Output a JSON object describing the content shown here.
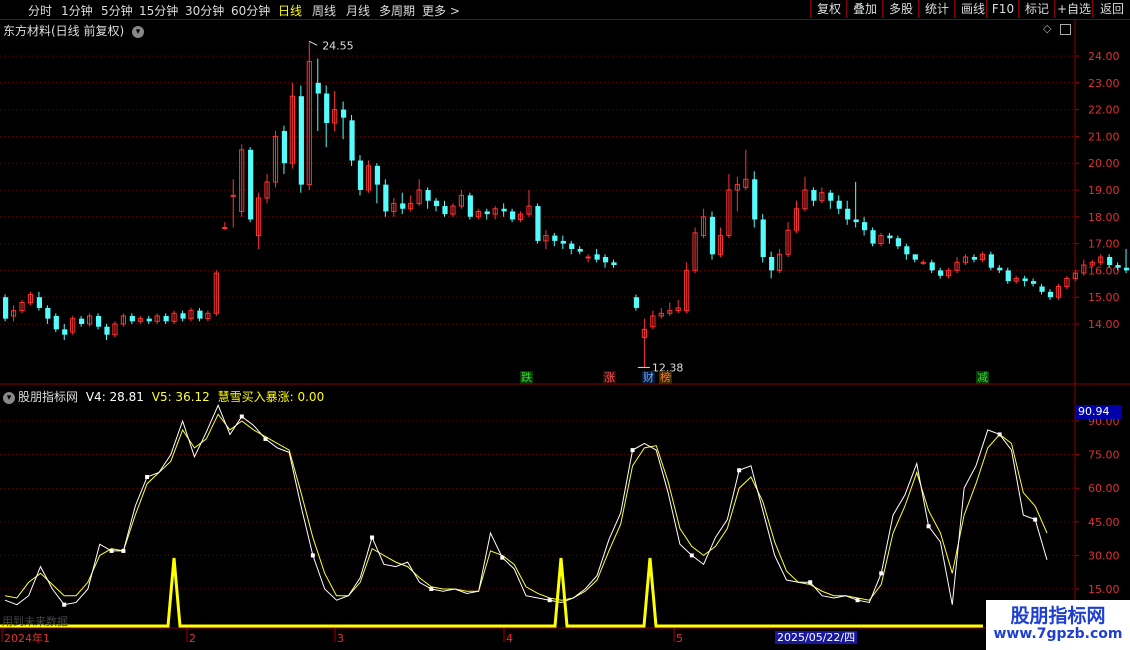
{
  "toolbar": {
    "periods": [
      "分时",
      "1分钟",
      "5分钟",
      "15分钟",
      "30分钟",
      "60分钟",
      "日线",
      "周线",
      "月线",
      "多周期",
      "更多 >"
    ],
    "active_period": "日线",
    "right_buttons": [
      "复权",
      "叠加",
      "多股",
      "统计",
      "画线",
      "F10",
      "标记",
      "+自选",
      "返回"
    ]
  },
  "stock_title": "东方材料(日线 前复权)",
  "main_axis_labels": [
    "24.00",
    "23.00",
    "22.00",
    "21.00",
    "20.00",
    "19.00",
    "18.00",
    "17.00",
    "16.00",
    "15.00",
    "14.00"
  ],
  "high_label": "24.55",
  "low_label": "12.38",
  "signals": [
    {
      "text": "跌",
      "color": "#33dd33",
      "bg": "#0a3a0a"
    },
    {
      "text": "涨",
      "color": "#ff5555",
      "bg": "#3a0a0a"
    },
    {
      "text": "财",
      "color": "#66aaff",
      "bg": "#0a1a3a"
    },
    {
      "text": "榜",
      "color": "#ff7733",
      "bg": "#3a2a00"
    },
    {
      "text": "减",
      "color": "#33dd33",
      "bg": "#0a3a0a"
    }
  ],
  "indicator": {
    "name": "股朋指标网",
    "v4_label": "V4: 28.81",
    "v5_label": "V5: 36.12",
    "buy_label": "慧雪买入暴涨: 0.00",
    "top_value": "90.94",
    "axis_labels": [
      "90.00",
      "75.00",
      "60.00",
      "45.00",
      "30.00",
      "15.00"
    ]
  },
  "ghost_text": "用到未来数据",
  "date_axis": [
    "2024年1",
    "2",
    "3",
    "4",
    "5"
  ],
  "date_highlight": "2025/05/22/四",
  "watermark": {
    "line1": "股朋指标网",
    "line2": "www.7gpzb.com"
  },
  "colors": {
    "up": "#ff3232",
    "down": "#54fcfc",
    "v4": "#ffffff",
    "v5": "#ffff33",
    "buy": "#ffff00",
    "grid": "#6e0000"
  },
  "chart_data": [
    {
      "type": "candlestick",
      "title": "东方材料(日线 前复权)",
      "ylim": [
        13.0,
        24.9
      ],
      "y_ticks": [
        14,
        15,
        16,
        17,
        18,
        19,
        20,
        21,
        22,
        23,
        24
      ],
      "annotations": [
        {
          "text": "24.55",
          "value": 24.55
        },
        {
          "text": "12.38",
          "value": 12.38
        }
      ],
      "candles": [
        [
          15.0,
          14.2,
          15.1,
          14.1
        ],
        [
          14.3,
          14.5,
          14.7,
          14.1
        ],
        [
          14.5,
          14.8,
          14.9,
          14.4
        ],
        [
          14.8,
          15.1,
          15.2,
          14.7
        ],
        [
          15.0,
          14.6,
          15.2,
          14.5
        ],
        [
          14.6,
          14.2,
          14.7,
          14.0
        ],
        [
          14.3,
          13.8,
          14.4,
          13.7
        ],
        [
          13.8,
          13.6,
          14.0,
          13.4
        ],
        [
          13.7,
          14.2,
          14.3,
          13.6
        ],
        [
          14.2,
          14.0,
          14.3,
          13.9
        ],
        [
          14.0,
          14.3,
          14.4,
          13.9
        ],
        [
          14.3,
          13.9,
          14.4,
          13.8
        ],
        [
          13.9,
          13.6,
          14.0,
          13.4
        ],
        [
          13.6,
          14.0,
          14.1,
          13.5
        ],
        [
          14.0,
          14.3,
          14.4,
          13.9
        ],
        [
          14.3,
          14.1,
          14.4,
          14.0
        ],
        [
          14.1,
          14.2,
          14.3,
          14.0
        ],
        [
          14.2,
          14.1,
          14.3,
          14.0
        ],
        [
          14.1,
          14.3,
          14.4,
          14.0
        ],
        [
          14.3,
          14.1,
          14.4,
          14.0
        ],
        [
          14.1,
          14.4,
          14.5,
          14.0
        ],
        [
          14.4,
          14.2,
          14.5,
          14.1
        ],
        [
          14.2,
          14.5,
          14.6,
          14.1
        ],
        [
          14.5,
          14.2,
          14.6,
          14.1
        ],
        [
          14.2,
          14.4,
          14.5,
          14.1
        ],
        [
          14.4,
          15.9,
          16.0,
          14.3
        ],
        [
          17.6,
          17.6,
          17.8,
          17.5
        ],
        [
          18.8,
          18.8,
          19.4,
          17.6
        ],
        [
          18.2,
          20.5,
          20.7,
          18.0
        ],
        [
          20.5,
          17.9,
          20.6,
          17.8
        ],
        [
          17.3,
          18.7,
          18.9,
          16.8
        ],
        [
          18.7,
          19.3,
          19.6,
          18.5
        ],
        [
          19.3,
          21.0,
          21.2,
          19.1
        ],
        [
          21.2,
          20.0,
          21.4,
          19.6
        ],
        [
          20.0,
          22.5,
          23.0,
          19.8
        ],
        [
          22.5,
          19.2,
          22.9,
          18.9
        ],
        [
          19.2,
          23.8,
          24.55,
          19.0
        ],
        [
          23.0,
          22.6,
          23.9,
          21.2
        ],
        [
          22.6,
          21.5,
          22.9,
          20.6
        ],
        [
          21.5,
          22.0,
          22.7,
          21.2
        ],
        [
          22.0,
          21.7,
          22.3,
          20.9
        ],
        [
          21.6,
          20.1,
          21.8,
          19.9
        ],
        [
          20.1,
          19.0,
          20.3,
          18.8
        ],
        [
          19.0,
          19.9,
          20.1,
          18.9
        ],
        [
          19.9,
          19.2,
          20.0,
          18.5
        ],
        [
          19.2,
          18.2,
          19.4,
          18.0
        ],
        [
          18.2,
          18.5,
          18.7,
          18.0
        ],
        [
          18.5,
          18.3,
          18.9,
          18.1
        ],
        [
          18.3,
          18.5,
          18.8,
          18.2
        ],
        [
          18.5,
          19.0,
          19.4,
          18.4
        ],
        [
          19.0,
          18.6,
          19.1,
          18.3
        ],
        [
          18.6,
          18.4,
          18.7,
          18.2
        ],
        [
          18.4,
          18.1,
          18.6,
          18.0
        ],
        [
          18.1,
          18.4,
          18.5,
          18.0
        ],
        [
          18.4,
          18.8,
          19.0,
          18.3
        ],
        [
          18.8,
          18.0,
          18.9,
          17.9
        ],
        [
          18.0,
          18.2,
          18.3,
          17.9
        ],
        [
          18.2,
          18.1,
          18.3,
          17.9
        ],
        [
          18.1,
          18.3,
          18.4,
          17.9
        ],
        [
          18.3,
          18.2,
          18.5,
          18.0
        ],
        [
          18.2,
          17.9,
          18.3,
          17.8
        ],
        [
          17.9,
          18.1,
          18.2,
          17.8
        ],
        [
          18.1,
          18.4,
          19.0,
          18.0
        ],
        [
          18.4,
          17.1,
          18.5,
          17.0
        ],
        [
          17.1,
          17.3,
          17.5,
          16.8
        ],
        [
          17.3,
          17.1,
          17.4,
          16.9
        ],
        [
          17.1,
          17.0,
          17.3,
          16.8
        ],
        [
          17.0,
          16.8,
          17.1,
          16.6
        ],
        [
          16.8,
          16.7,
          16.9,
          16.6
        ],
        [
          16.5,
          16.5,
          16.6,
          16.3
        ],
        [
          16.6,
          16.4,
          16.8,
          16.3
        ],
        [
          16.5,
          16.3,
          16.6,
          16.1
        ],
        [
          16.3,
          16.2,
          16.4,
          16.1
        ],
        [
          15.0,
          14.6,
          15.1,
          14.5
        ],
        [
          13.5,
          13.8,
          14.2,
          12.38
        ],
        [
          13.9,
          14.3,
          14.5,
          13.8
        ],
        [
          14.3,
          14.4,
          14.6,
          14.2
        ],
        [
          14.4,
          14.5,
          14.8,
          14.3
        ],
        [
          14.5,
          14.6,
          14.9,
          14.4
        ],
        [
          14.5,
          16.0,
          16.3,
          14.4
        ],
        [
          16.0,
          17.4,
          17.6,
          15.9
        ],
        [
          17.3,
          18.0,
          18.3,
          17.2
        ],
        [
          18.0,
          16.6,
          18.2,
          16.4
        ],
        [
          16.6,
          17.3,
          17.6,
          16.5
        ],
        [
          17.3,
          19.0,
          19.6,
          17.2
        ],
        [
          19.0,
          19.2,
          19.5,
          18.2
        ],
        [
          19.1,
          19.4,
          20.5,
          19.0
        ],
        [
          19.4,
          17.9,
          19.7,
          17.6
        ],
        [
          17.9,
          16.5,
          18.1,
          16.3
        ],
        [
          16.5,
          16.0,
          16.7,
          15.7
        ],
        [
          16.0,
          16.6,
          16.8,
          15.9
        ],
        [
          16.6,
          17.5,
          17.8,
          16.5
        ],
        [
          17.5,
          18.3,
          18.6,
          17.4
        ],
        [
          18.3,
          19.0,
          19.5,
          18.2
        ],
        [
          19.0,
          18.6,
          19.1,
          18.4
        ],
        [
          18.6,
          18.9,
          19.1,
          18.5
        ],
        [
          18.9,
          18.6,
          19.0,
          18.3
        ],
        [
          18.6,
          18.3,
          18.8,
          18.1
        ],
        [
          18.3,
          17.9,
          18.6,
          17.7
        ],
        [
          17.9,
          17.8,
          19.3,
          17.6
        ],
        [
          17.8,
          17.5,
          18.0,
          17.3
        ],
        [
          17.5,
          17.0,
          17.6,
          16.9
        ],
        [
          17.0,
          17.3,
          17.4,
          16.9
        ],
        [
          17.3,
          17.2,
          17.4,
          17.0
        ],
        [
          17.2,
          16.9,
          17.3,
          16.8
        ],
        [
          16.9,
          16.6,
          17.0,
          16.4
        ],
        [
          16.6,
          16.4,
          16.6,
          16.3
        ],
        [
          16.3,
          16.3,
          16.4,
          16.2
        ],
        [
          16.3,
          16.0,
          16.4,
          15.9
        ],
        [
          16.0,
          15.8,
          16.1,
          15.7
        ],
        [
          15.8,
          16.0,
          16.1,
          15.7
        ],
        [
          16.0,
          16.3,
          16.5,
          15.9
        ],
        [
          16.3,
          16.5,
          16.6,
          16.2
        ],
        [
          16.5,
          16.4,
          16.6,
          16.3
        ],
        [
          16.4,
          16.6,
          16.7,
          16.3
        ],
        [
          16.6,
          16.1,
          16.7,
          16.0
        ],
        [
          16.1,
          16.0,
          16.2,
          15.9
        ],
        [
          16.0,
          15.6,
          16.1,
          15.5
        ],
        [
          15.6,
          15.7,
          15.8,
          15.5
        ],
        [
          15.7,
          15.6,
          15.8,
          15.4
        ],
        [
          15.6,
          15.5,
          15.7,
          15.4
        ],
        [
          15.4,
          15.2,
          15.5,
          15.1
        ],
        [
          15.2,
          15.0,
          15.3,
          14.9
        ],
        [
          15.0,
          15.4,
          15.5,
          14.9
        ],
        [
          15.4,
          15.7,
          15.8,
          15.3
        ],
        [
          15.7,
          15.9,
          16.0,
          15.6
        ],
        [
          15.9,
          16.2,
          16.4,
          15.8
        ],
        [
          16.2,
          16.3,
          16.4,
          16.1
        ],
        [
          16.3,
          16.5,
          16.6,
          16.2
        ],
        [
          16.5,
          16.2,
          16.6,
          16.1
        ],
        [
          16.2,
          16.1,
          16.3,
          16.0
        ],
        [
          16.1,
          16.0,
          16.8,
          15.9
        ],
        [
          16.0,
          15.8,
          16.1,
          15.7
        ],
        [
          15.8,
          16.2,
          16.3,
          15.7
        ],
        [
          16.2,
          16.1,
          16.3,
          16.0
        ],
        [
          16.1,
          16.0,
          16.2,
          15.9
        ]
      ]
    },
    {
      "type": "line",
      "title": "股朋指标网",
      "ylim": [
        8,
        98
      ],
      "y_ticks": [
        15,
        30,
        45,
        60,
        75,
        90
      ],
      "series": [
        {
          "name": "V4",
          "values": [
            10,
            8,
            12,
            25,
            15,
            8,
            9,
            15,
            35,
            32,
            32,
            52,
            65,
            67,
            75,
            90,
            74,
            85,
            97,
            84,
            92,
            88,
            82,
            78,
            76,
            52,
            30,
            15,
            10,
            12,
            20,
            38,
            26,
            25,
            27,
            18,
            15,
            14,
            15,
            13,
            14,
            40,
            29,
            24,
            12,
            11,
            10,
            9,
            11,
            15,
            21,
            37,
            49,
            77,
            80,
            77,
            58,
            35,
            30,
            26,
            38,
            46,
            68,
            70,
            50,
            30,
            19,
            18,
            18,
            12,
            11,
            12,
            10,
            9,
            22,
            48,
            57,
            71,
            43,
            36,
            8,
            60,
            70,
            86,
            84,
            77,
            48,
            46,
            28
          ]
        },
        {
          "name": "V5",
          "values": [
            12,
            11,
            18,
            22,
            17,
            12,
            12,
            18,
            30,
            33,
            32,
            48,
            62,
            67,
            72,
            86,
            78,
            82,
            93,
            86,
            90,
            86,
            83,
            80,
            77,
            58,
            38,
            22,
            12,
            12,
            18,
            33,
            30,
            27,
            25,
            20,
            16,
            15,
            15,
            14,
            14,
            32,
            30,
            26,
            16,
            13,
            11,
            10,
            11,
            14,
            19,
            32,
            44,
            70,
            78,
            79,
            63,
            42,
            34,
            30,
            34,
            42,
            60,
            65,
            54,
            36,
            23,
            18,
            17,
            14,
            12,
            12,
            11,
            10,
            17,
            40,
            52,
            67,
            50,
            40,
            22,
            48,
            62,
            78,
            84,
            80,
            58,
            52,
            40
          ]
        },
        {
          "name": "慧雪买入暴涨",
          "values": [
            0,
            0,
            0,
            0,
            0,
            0,
            0,
            0,
            0,
            0,
            0,
            0,
            0,
            0,
            0,
            0,
            0,
            0,
            0,
            0,
            0,
            0,
            0,
            0,
            0,
            0,
            0,
            0,
            0,
            0,
            0,
            0,
            0,
            0,
            0,
            0,
            0,
            0,
            0,
            0,
            0,
            0,
            0,
            0,
            0,
            0,
            0,
            0,
            0,
            0,
            0,
            0,
            0,
            0,
            0,
            0,
            0,
            0,
            0,
            0,
            0,
            0,
            0,
            0,
            0,
            0,
            0,
            0,
            0,
            0,
            0,
            0,
            0,
            0,
            0,
            0,
            0,
            0,
            0,
            0,
            0,
            0,
            0,
            0,
            0,
            0,
            0,
            0,
            0
          ]
        }
      ]
    }
  ]
}
